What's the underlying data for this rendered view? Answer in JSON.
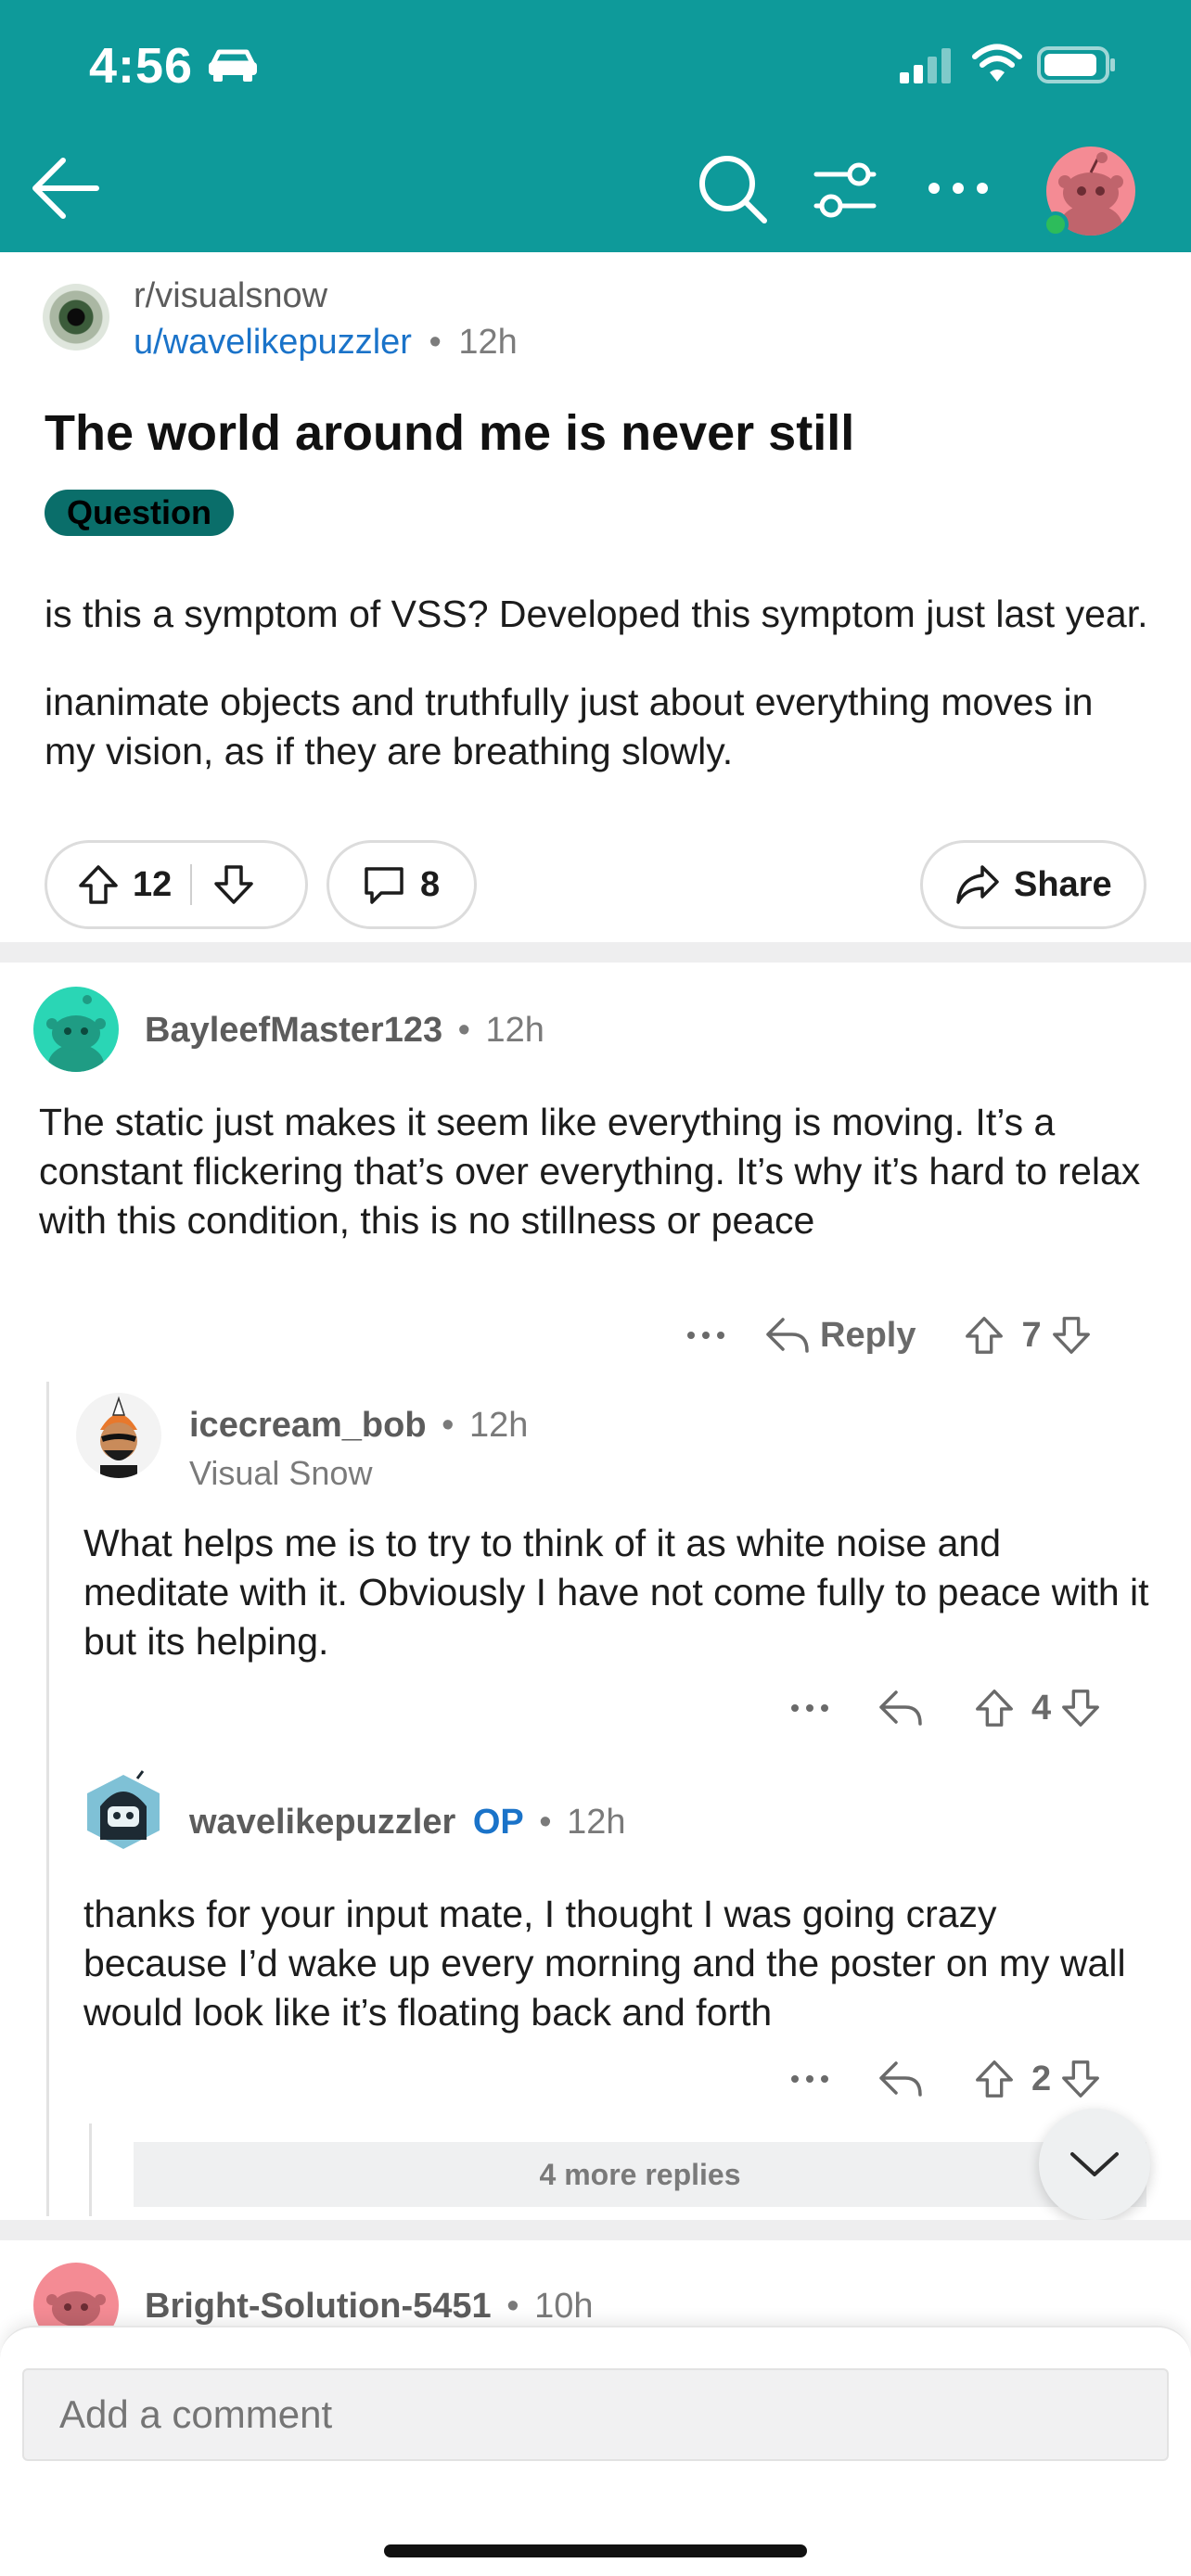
{
  "status": {
    "time": "4:56"
  },
  "post": {
    "subreddit": "r/visualsnow",
    "author": "u/wavelikepuzzler",
    "separator": "•",
    "age": "12h",
    "title": "The world around me is never still",
    "flair": "Question",
    "body": [
      "is this a symptom of VSS? Developed this symptom just last year.",
      "inanimate objects and truthfully just about everything moves in my vision, as if they are breathing slowly."
    ],
    "votes": "12",
    "comments": "8",
    "share_label": "Share"
  },
  "comments": [
    {
      "author": "BayleefMaster123",
      "age": "12h",
      "body": "The static just makes it seem like everything is moving. It’s a constant flickering that’s over everything.  It’s why it’s hard to relax with this condition, this is no stillness or peace",
      "reply_label": "Reply",
      "votes": "7"
    },
    {
      "author": "icecream_bob",
      "age": "12h",
      "user_flair": "Visual Snow",
      "body": "What helps me is to try to think of it as white noise and meditate with it. Obviously I have not come fully to peace with it but its helping.",
      "votes": "4"
    },
    {
      "author": "wavelikepuzzler",
      "op_badge": "OP",
      "age": "12h",
      "body": "thanks for your input mate, I thought I was going crazy because I’d wake up every morning and the poster on my wall would look like it’s floating back and forth",
      "votes": "2"
    },
    {
      "author": "Bright-Solution-5451",
      "age": "10h"
    }
  ],
  "more_replies": "4 more replies",
  "comment_box": {
    "placeholder": "Add a comment"
  },
  "colors": {
    "header": "#0e9a9a",
    "link": "#1a73c9",
    "flair": "#0a6e6a"
  }
}
